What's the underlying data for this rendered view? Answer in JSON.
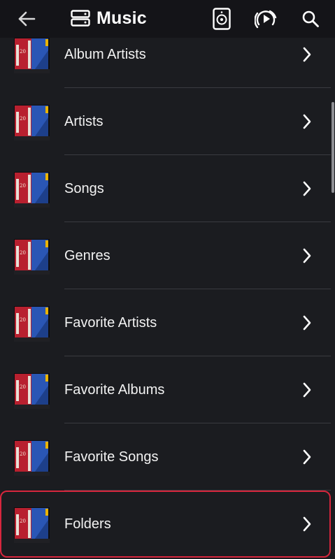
{
  "header": {
    "back_icon": "arrow-left-icon",
    "server_icon": "server-icon",
    "title": "Music",
    "actions": [
      {
        "name": "speaker-icon"
      },
      {
        "name": "cast-play-icon"
      },
      {
        "name": "search-icon"
      }
    ]
  },
  "list": {
    "items": [
      {
        "label": "Album Artists"
      },
      {
        "label": "Artists"
      },
      {
        "label": "Songs"
      },
      {
        "label": "Genres"
      },
      {
        "label": "Favorite Artists"
      },
      {
        "label": "Favorite Albums"
      },
      {
        "label": "Favorite Songs"
      },
      {
        "label": "Folders",
        "highlighted": true
      }
    ]
  },
  "colors": {
    "background": "#1b1c20",
    "toolbar": "#141418",
    "divider": "#3a3b40",
    "highlight_border": "#d7263d",
    "text": "#f2f2f2"
  }
}
